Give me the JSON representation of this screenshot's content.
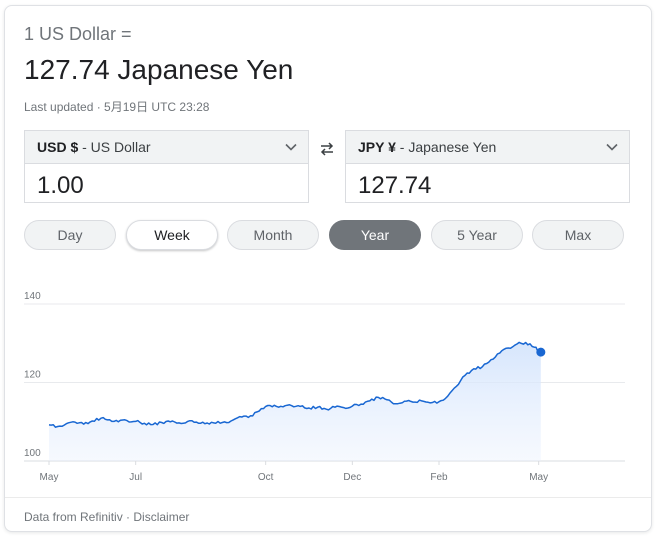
{
  "header": {
    "from_phrase": "1 US Dollar =",
    "result_phrase": "127.74 Japanese Yen",
    "last_updated": "Last updated · 5月19日 UTC 23:28"
  },
  "converter": {
    "from": {
      "code": "USD $",
      "name": " - US Dollar",
      "amount": "1.00"
    },
    "to": {
      "code": "JPY ¥",
      "name": " - Japanese Yen",
      "amount": "127.74"
    }
  },
  "ranges": [
    {
      "label": "Day",
      "state": "normal"
    },
    {
      "label": "Week",
      "state": "hover"
    },
    {
      "label": "Month",
      "state": "normal"
    },
    {
      "label": "Year",
      "state": "active"
    },
    {
      "label": "5 Year",
      "state": "normal"
    },
    {
      "label": "Max",
      "state": "normal"
    }
  ],
  "colors": {
    "line": "#1a73e8",
    "line_dark": "#1967d2",
    "fill": "#e8f0fe",
    "grid": "#e8eaed",
    "active_range": "#70757a"
  },
  "chart_data": {
    "type": "area",
    "title": "",
    "xlabel": "",
    "ylabel": "",
    "ylim": [
      100,
      140
    ],
    "yticks": [
      100,
      120,
      140
    ],
    "xticks": [
      "May",
      "Jul",
      "Oct",
      "Dec",
      "Feb",
      "May"
    ],
    "x_tick_positions": [
      0,
      2,
      5,
      7,
      9,
      11.3
    ],
    "x_range": [
      0,
      12.6
    ],
    "grid": true,
    "series": [
      {
        "x": [
          0,
          0.2,
          0.4,
          0.6,
          0.8,
          1.0,
          1.2,
          1.4,
          1.6,
          1.8,
          2.0,
          2.2,
          2.4,
          2.6,
          2.8,
          3.0,
          3.2,
          3.4,
          3.6,
          3.8,
          4.0,
          4.2,
          4.4,
          4.6,
          4.8,
          5.0,
          5.2,
          5.4,
          5.6,
          5.8,
          6.0,
          6.2,
          6.4,
          6.6,
          6.8,
          7.0,
          7.2,
          7.4,
          7.6,
          7.8,
          8.0,
          8.2,
          8.4,
          8.6,
          8.8,
          9.0,
          9.2,
          9.4,
          9.6,
          9.8,
          10.0,
          10.2,
          10.4,
          10.6,
          10.8,
          11.0,
          11.2,
          11.35
        ],
        "values": [
          109.2,
          108.8,
          109.5,
          109.9,
          109.4,
          110.2,
          110.9,
          110.5,
          110.0,
          110.3,
          110.1,
          109.6,
          109.3,
          109.8,
          110.0,
          109.7,
          110.1,
          109.9,
          109.5,
          109.7,
          109.8,
          110.2,
          111.3,
          111.1,
          112.5,
          113.9,
          114.2,
          113.8,
          114.1,
          113.9,
          113.5,
          113.7,
          113.2,
          113.7,
          113.6,
          114.0,
          114.5,
          115.3,
          116.2,
          115.6,
          114.6,
          115.2,
          115.0,
          115.3,
          114.8,
          115.1,
          116.5,
          119.0,
          121.8,
          123.5,
          124.0,
          125.8,
          127.5,
          128.8,
          129.8,
          130.2,
          129.0,
          127.74
        ]
      }
    ]
  },
  "footer": {
    "source": "Data from Refinitiv",
    "sep": " · ",
    "disclaimer": "Disclaimer"
  }
}
